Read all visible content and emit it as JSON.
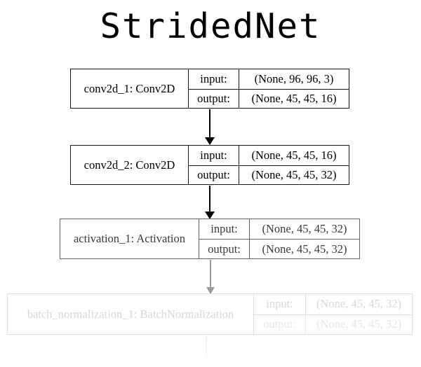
{
  "title": "StridedNet",
  "diagram": {
    "io_labels": {
      "input": "input:",
      "output": "output:"
    },
    "layers": [
      {
        "id": "conv2d_1",
        "name": "conv2d_1: Conv2D",
        "input_shape": "(None, 96, 96, 3)",
        "output_shape": "(None, 45, 45, 16)",
        "opacity_tier": 1
      },
      {
        "id": "conv2d_2",
        "name": "conv2d_2: Conv2D",
        "input_shape": "(None, 45, 45, 16)",
        "output_shape": "(None, 45, 45, 32)",
        "opacity_tier": 2
      },
      {
        "id": "activation_1",
        "name": "activation_1: Activation",
        "input_shape": "(None, 45, 45, 32)",
        "output_shape": "(None, 45, 45, 32)",
        "opacity_tier": 3
      },
      {
        "id": "batch_normalization_1",
        "name": "batch_normalization_1: BatchNormalization",
        "input_shape": "(None, 45, 45, 32)",
        "output_shape": "(None, 45, 45, 32)",
        "opacity_tier": 4
      }
    ],
    "edges": [
      {
        "from": "conv2d_1",
        "to": "conv2d_2"
      },
      {
        "from": "conv2d_2",
        "to": "activation_1"
      },
      {
        "from": "activation_1",
        "to": "batch_normalization_1"
      }
    ],
    "colors": {
      "background": "#ffffff",
      "ink_strong": "#000000",
      "ink_mid": "#3b3b3b",
      "ink_faint": "#d8d8d8",
      "arrow_faint": "#9a9a9a"
    }
  }
}
